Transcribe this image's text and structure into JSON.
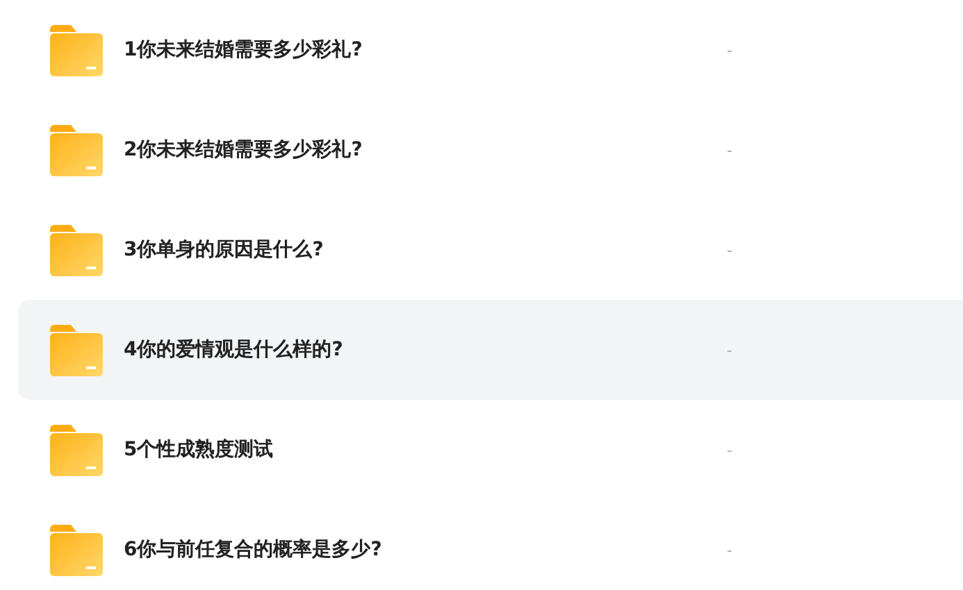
{
  "files": [
    {
      "name": "1你未来结婚需要多少彩礼?",
      "detail": "-",
      "selected": false
    },
    {
      "name": "2你未来结婚需要多少彩礼?",
      "detail": "-",
      "selected": false
    },
    {
      "name": "3你单身的原因是什么?",
      "detail": "-",
      "selected": false
    },
    {
      "name": "4你的爱情观是什么样的?",
      "detail": "-",
      "selected": true
    },
    {
      "name": "5个性成熟度测试",
      "detail": "-",
      "selected": false
    },
    {
      "name": "6你与前任复合的概率是多少?",
      "detail": "-",
      "selected": false
    }
  ]
}
